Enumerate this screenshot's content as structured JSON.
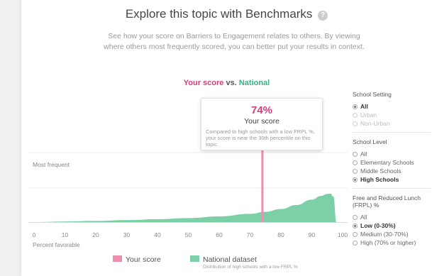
{
  "header": {
    "title": "Explore this topic with Benchmarks",
    "help_icon": "?",
    "description": "See how your score on Barriers to Engagement relates to others. By viewing where others most frequently scored, you can better put your results in context."
  },
  "comparison": {
    "your_score": "Your score",
    "vs": "vs.",
    "national": "National"
  },
  "tooltip": {
    "percent": "74%",
    "label": "Your score",
    "note": "Compared to high schools with a low FRPL %, your score is near the 30th percentile on this topic."
  },
  "chart_data": {
    "type": "area",
    "ylabel": "Most frequent",
    "xlabel": "Percent favorable",
    "xlim": [
      0,
      100
    ],
    "x_ticks": [
      "0",
      "10",
      "20",
      "30",
      "40",
      "50",
      "60",
      "70",
      "80",
      "90",
      "100"
    ],
    "your_score": 74,
    "series": [
      {
        "name": "National dataset",
        "x": [
          0,
          10,
          20,
          30,
          40,
          50,
          60,
          70,
          75,
          80,
          85,
          90,
          93,
          95,
          96,
          97,
          98
        ],
        "y": [
          0.0,
          0.02,
          0.04,
          0.07,
          0.1,
          0.14,
          0.2,
          0.29,
          0.36,
          0.46,
          0.6,
          0.79,
          0.92,
          0.99,
          1.0,
          0.9,
          0.0
        ]
      }
    ],
    "colors": {
      "your_score": "#ef8db1",
      "national": "#7ccfa7"
    }
  },
  "legend": {
    "your_score": "Your score",
    "national": "National dataset",
    "national_sub": "Distribution of high schools with a low FRPL %"
  },
  "sidebar": {
    "school_setting": {
      "heading": "School Setting",
      "options": [
        {
          "label": "All",
          "selected": true,
          "disabled": false
        },
        {
          "label": "Urban",
          "selected": false,
          "disabled": true
        },
        {
          "label": "Non-Urban",
          "selected": false,
          "disabled": true
        }
      ]
    },
    "school_level": {
      "heading": "School Level",
      "options": [
        {
          "label": "All",
          "selected": false,
          "disabled": false
        },
        {
          "label": "Elementary Schools",
          "selected": false,
          "disabled": false
        },
        {
          "label": "Middle Schools",
          "selected": false,
          "disabled": false
        },
        {
          "label": "High Schools",
          "selected": true,
          "disabled": false
        }
      ]
    },
    "frpl": {
      "heading": "Free and Reduced Lunch (FRPL) %",
      "options": [
        {
          "label": "All",
          "selected": false,
          "disabled": false
        },
        {
          "label": "Low (0-30%)",
          "selected": true,
          "disabled": false
        },
        {
          "label": "Medium (30-70%)",
          "selected": false,
          "disabled": false
        },
        {
          "label": "High (70% or higher)",
          "selected": false,
          "disabled": false
        }
      ]
    }
  }
}
